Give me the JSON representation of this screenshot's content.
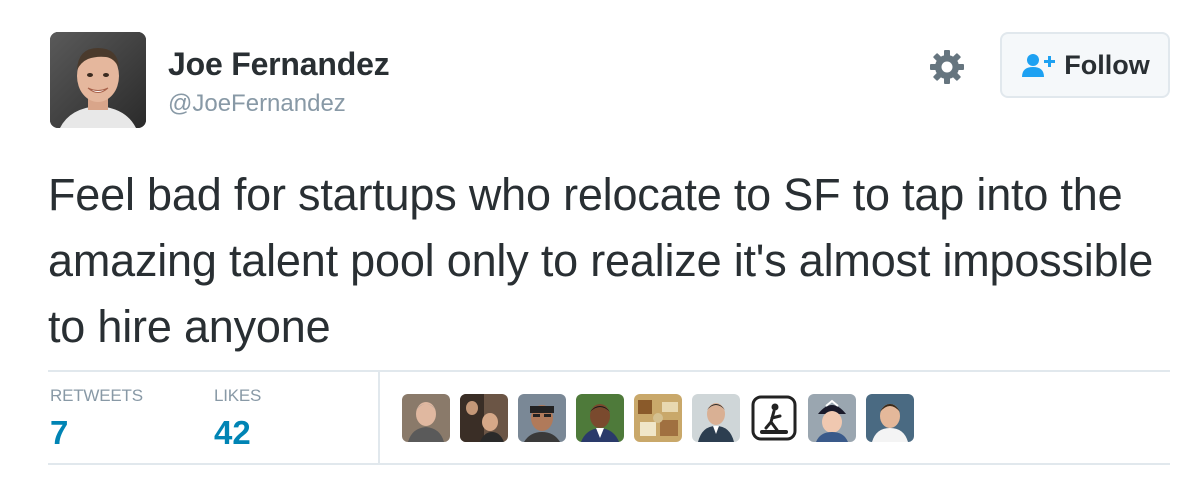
{
  "user": {
    "name": "Joe Fernandez",
    "handle": "@JoeFernandez",
    "avatar_icon": "profile-photo"
  },
  "actions": {
    "follow_label": "Follow",
    "follow_icon": "add-user-icon",
    "settings_icon": "gear-icon"
  },
  "tweet": {
    "text": "Feel bad for startups who relocate to SF to tap into the amazing talent pool only to realize it's almost impossible to hire anyone"
  },
  "stats": {
    "retweets_label": "RETWEETS",
    "retweets_count": "7",
    "likes_label": "LIKES",
    "likes_count": "42"
  },
  "likers": [
    "liker-avatar",
    "liker-avatar",
    "liker-avatar",
    "liker-avatar",
    "liker-avatar",
    "liker-avatar",
    "liker-avatar",
    "liker-avatar",
    "liker-avatar"
  ],
  "colors": {
    "accent_blue": "#1da1f2",
    "count_blue": "#0084b4",
    "muted_gray": "#8899a6",
    "text_dark": "#292f33",
    "border": "#e1e8ed"
  }
}
